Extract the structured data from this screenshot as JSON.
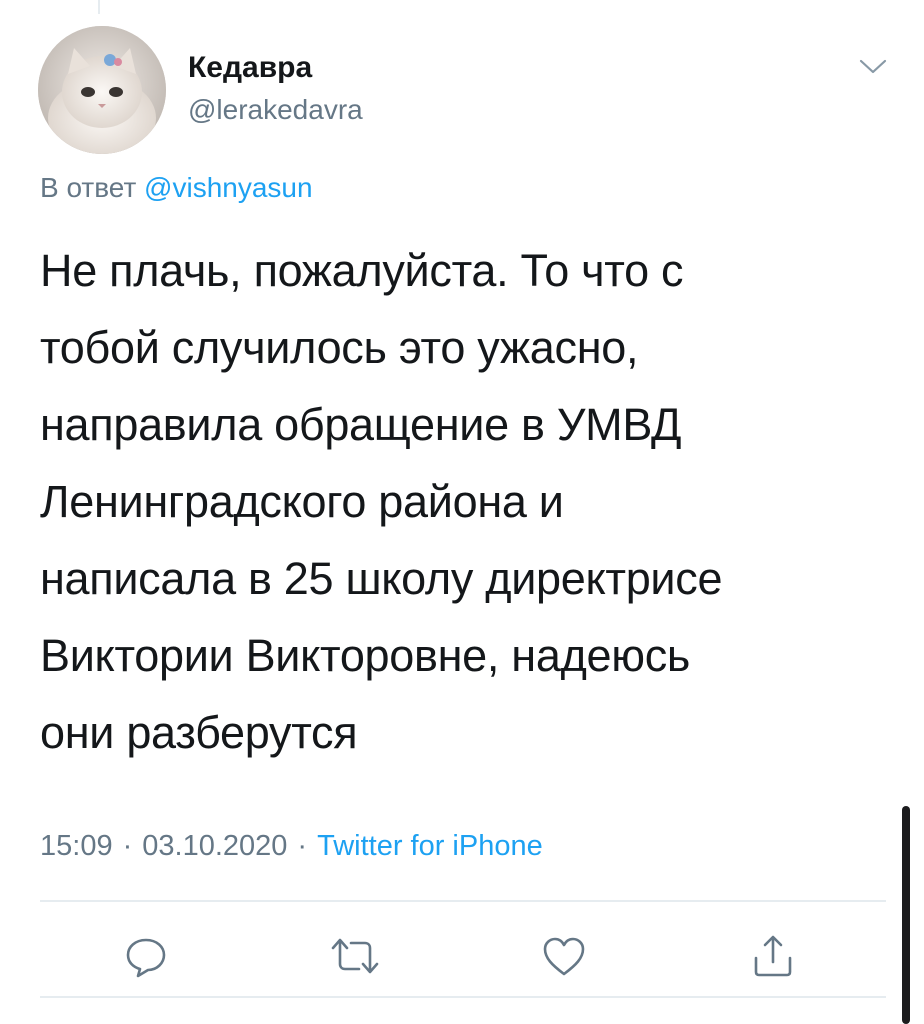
{
  "author": {
    "display_name": "Кедавра",
    "handle": "@lerakedavra"
  },
  "reply": {
    "prefix": "В ответ",
    "mention": "@vishnyasun"
  },
  "tweet": {
    "text": "Не плачь, пожалуйста. То что с\nтобой случилось это ужасно,\nнаправила обращение в УМВД\nЛенинградского района и\nнаписала в 25 школу директрисе\nВиктории Викторовне, надеюсь\nони разберутся"
  },
  "meta": {
    "time": "15:09",
    "separator": "·",
    "date": "03.10.2020",
    "source": "Twitter for iPhone"
  },
  "actions": [
    {
      "icon": "reply-icon"
    },
    {
      "icon": "retweet-icon"
    },
    {
      "icon": "like-icon"
    },
    {
      "icon": "share-icon"
    }
  ],
  "colors": {
    "text": "#14171a",
    "secondary": "#657786",
    "link": "#1da1f2",
    "divider": "#e6ecf0"
  }
}
